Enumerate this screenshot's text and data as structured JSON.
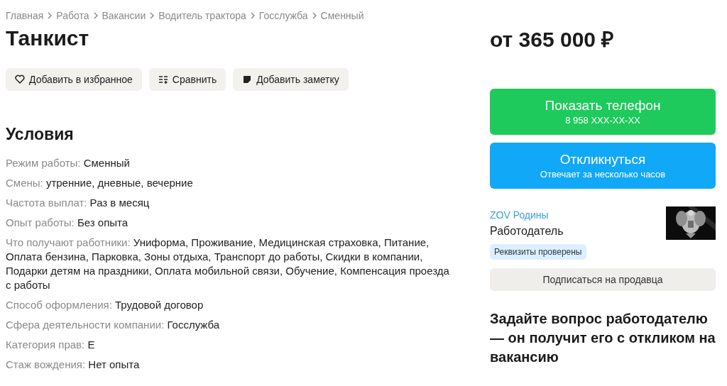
{
  "breadcrumbs": [
    "Главная",
    "Работа",
    "Вакансии",
    "Водитель трактора",
    "Госслужба",
    "Сменный"
  ],
  "title": "Танкист",
  "actions": [
    {
      "kind": "favorite",
      "label": "Добавить в избранное"
    },
    {
      "kind": "compare",
      "label": "Сравнить"
    },
    {
      "kind": "note",
      "label": "Добавить заметку"
    }
  ],
  "conditions": {
    "heading": "Условия",
    "items": [
      {
        "label": "Режим работы:",
        "value": "Сменный"
      },
      {
        "label": "Смены:",
        "value": "утренние, дневные, вечерние"
      },
      {
        "label": "Частота выплат:",
        "value": "Раз в месяц"
      },
      {
        "label": "Опыт работы:",
        "value": "Без опыта"
      },
      {
        "label": "Что получают работники:",
        "value": "Униформа, Проживание, Медицинская страховка, Питание, Оплата бензина, Парковка, Зоны отдыха, Транспорт до работы, Скидки в компании, Подарки детям на праздники, Оплата мобильной связи, Обучение, Компенсация проезда с работы"
      },
      {
        "label": "Способ оформления:",
        "value": "Трудовой договор"
      },
      {
        "label": "Сфера деятельности компании:",
        "value": "Госслужба"
      },
      {
        "label": "Категория прав:",
        "value": "Е"
      },
      {
        "label": "Стаж вождения:",
        "value": "Нет опыта"
      }
    ]
  },
  "price": "от 365 000 ₽",
  "contact_buttons": [
    {
      "kind": "phone",
      "label": "Показать телефон",
      "sublabel": "8 958 XXX-XX-XX"
    },
    {
      "kind": "respond",
      "label": "Откликнуться",
      "sublabel": "Отвечает за несколько часов"
    }
  ],
  "seller": {
    "name": "ZOV Родины",
    "role": "Работодатель",
    "badge": "Реквизиты проверены",
    "subscribe": "Подписаться на продавца"
  },
  "question_heading": "Задайте вопрос работодателю — он получит его с откликом на вакансию"
}
